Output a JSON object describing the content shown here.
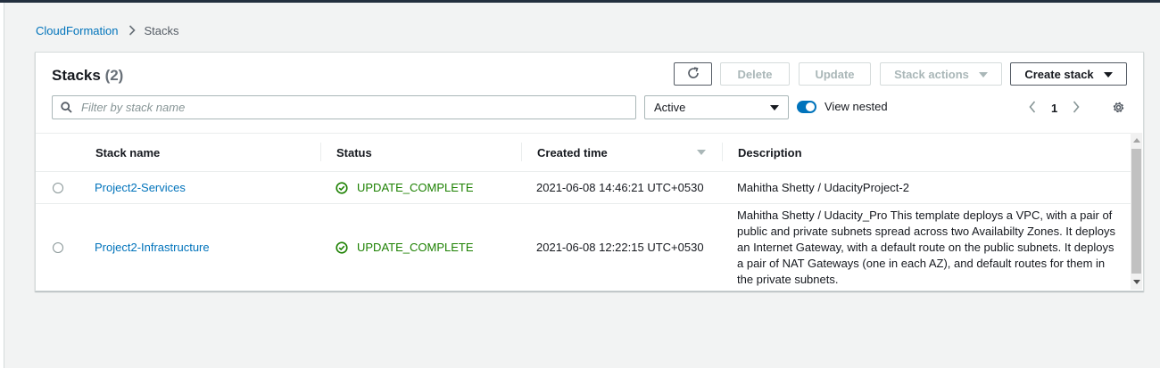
{
  "breadcrumb": {
    "root": "CloudFormation",
    "current": "Stacks"
  },
  "panel": {
    "title": "Stacks",
    "count": "(2)",
    "buttons": {
      "delete": "Delete",
      "update": "Update",
      "stack_actions": "Stack actions",
      "create_stack": "Create stack"
    }
  },
  "filter": {
    "placeholder": "Filter by stack name",
    "value": ""
  },
  "status_filter": {
    "selected": "Active"
  },
  "view_nested": {
    "label": "View nested",
    "enabled": true
  },
  "pagination": {
    "page": "1"
  },
  "table": {
    "columns": [
      "Stack name",
      "Status",
      "Created time",
      "Description"
    ],
    "rows": [
      {
        "name": "Project2-Services",
        "status": "UPDATE_COMPLETE",
        "created": "2021-06-08 14:46:21 UTC+0530",
        "description": "Mahitha Shetty / UdacityProject-2"
      },
      {
        "name": "Project2-Infrastructure",
        "status": "UPDATE_COMPLETE",
        "created": "2021-06-08 12:22:15 UTC+0530",
        "description": "Mahitha Shetty / Udacity_Pro This template deploys a VPC, with a pair of public and private subnets spread across two Availabilty Zones. It deploys an Internet Gateway, with a default route on the public subnets. It deploys a pair of NAT Gateways (one in each AZ), and default routes for them in the private subnets."
      }
    ]
  },
  "colors": {
    "link": "#0073bb",
    "success": "#1d8102",
    "topbar": "#232f3e"
  },
  "icons": [
    "chevron-right-icon",
    "refresh-icon",
    "caret-down-icon",
    "search-icon",
    "chevron-left-icon",
    "gear-icon",
    "success-check-icon",
    "sort-descending-icon"
  ]
}
